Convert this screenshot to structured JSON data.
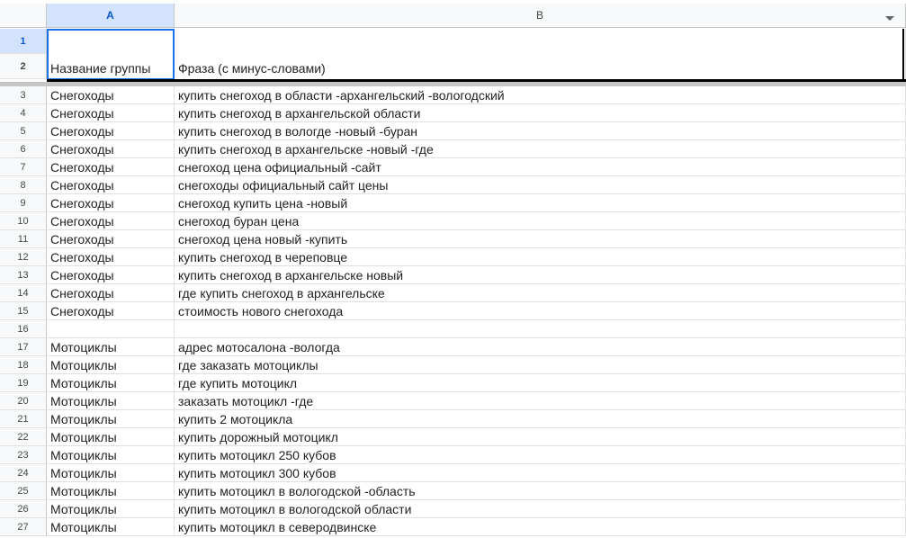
{
  "columns": {
    "a": "A",
    "b": "B"
  },
  "header": {
    "row1": "1",
    "row2": "2",
    "col_a": "Название группы",
    "col_b": "Фраза (с минус-словами)"
  },
  "rows": [
    {
      "n": "3",
      "a": "Снегоходы",
      "b": "купить снегоход в области -архангельский -вологодский"
    },
    {
      "n": "4",
      "a": "Снегоходы",
      "b": "купить снегоход в архангельской области"
    },
    {
      "n": "5",
      "a": "Снегоходы",
      "b": "купить снегоход в вологде -новый -буран"
    },
    {
      "n": "6",
      "a": "Снегоходы",
      "b": "купить снегоход в архангельске -новый -где"
    },
    {
      "n": "7",
      "a": "Снегоходы",
      "b": "снегоход цена официальный -сайт"
    },
    {
      "n": "8",
      "a": "Снегоходы",
      "b": "снегоходы официальный сайт цены"
    },
    {
      "n": "9",
      "a": "Снегоходы",
      "b": "снегоход купить цена -новый"
    },
    {
      "n": "10",
      "a": "Снегоходы",
      "b": "снегоход буран цена"
    },
    {
      "n": "11",
      "a": "Снегоходы",
      "b": "снегоход цена новый -купить"
    },
    {
      "n": "12",
      "a": "Снегоходы",
      "b": "купить снегоход в череповце"
    },
    {
      "n": "13",
      "a": "Снегоходы",
      "b": "купить снегоход в архангельске новый"
    },
    {
      "n": "14",
      "a": "Снегоходы",
      "b": "где купить снегоход в архангельске"
    },
    {
      "n": "15",
      "a": "Снегоходы",
      "b": "стоимость нового снегохода"
    },
    {
      "n": "16",
      "a": "",
      "b": ""
    },
    {
      "n": "17",
      "a": "Мотоциклы",
      "b": "адрес мотосалона -вологда"
    },
    {
      "n": "18",
      "a": "Мотоциклы",
      "b": "где заказать мотоциклы"
    },
    {
      "n": "19",
      "a": "Мотоциклы",
      "b": "где купить мотоцикл"
    },
    {
      "n": "20",
      "a": "Мотоциклы",
      "b": "заказать мотоцикл -где"
    },
    {
      "n": "21",
      "a": "Мотоциклы",
      "b": "купить 2 мотоцикла"
    },
    {
      "n": "22",
      "a": "Мотоциклы",
      "b": "купить дорожный мотоцикл"
    },
    {
      "n": "23",
      "a": "Мотоциклы",
      "b": "купить мотоцикл 250 кубов"
    },
    {
      "n": "24",
      "a": "Мотоциклы",
      "b": "купить мотоцикл 300 кубов"
    },
    {
      "n": "25",
      "a": "Мотоциклы",
      "b": "купить мотоцикл в вологодской -область"
    },
    {
      "n": "26",
      "a": "Мотоциклы",
      "b": "купить мотоцикл в вологодской области"
    },
    {
      "n": "27",
      "a": "Мотоциклы",
      "b": "купить мотоцикл в северодвинске"
    }
  ]
}
